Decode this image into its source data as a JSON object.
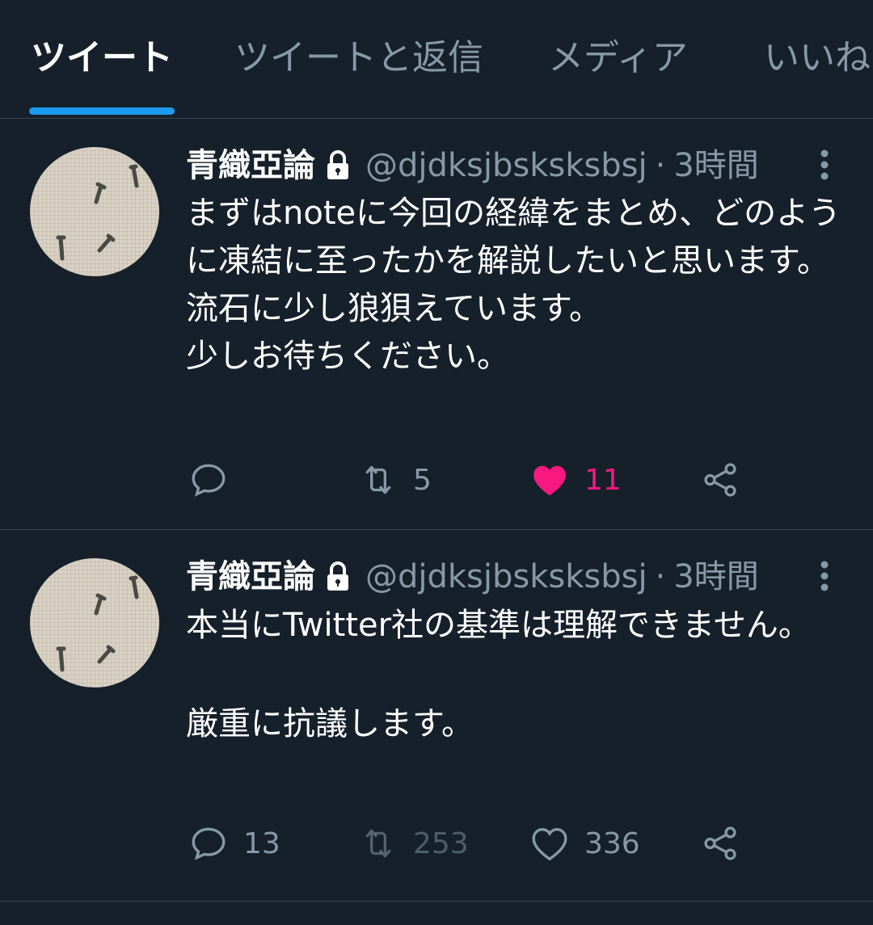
{
  "tabs": [
    {
      "label": "ツイート",
      "active": true
    },
    {
      "label": "ツイートと返信",
      "active": false
    },
    {
      "label": "メディア",
      "active": false
    },
    {
      "label": "いいね",
      "active": false
    }
  ],
  "tweets": [
    {
      "name": "青織亞論",
      "handle": "@djdksjbsksksbsj",
      "separator": "·",
      "time": "3時間",
      "text": "まずはnoteに今回の経緯をまとめ、どのように凍結に至ったかを解説したいと思います。\n流石に少し狼狽えています。\n少しお待ちください。",
      "replies": "",
      "retweets": "5",
      "likes": "11",
      "liked": true
    },
    {
      "name": "青織亞論",
      "handle": "@djdksjbsksksbsj",
      "separator": "·",
      "time": "3時間",
      "text": "本当にTwitter社の基準は理解できません。\n\n厳重に抗議します。",
      "replies": "13",
      "retweets": "253",
      "likes": "336",
      "liked": false
    }
  ],
  "colors": {
    "background": "#15202b",
    "accent": "#1d9bf0",
    "like": "#f91880",
    "secondary_text": "#8899a6",
    "divider": "#38444d"
  },
  "icons": {
    "lock": "lock-icon",
    "more": "more-vertical-icon",
    "reply": "reply-icon",
    "retweet": "retweet-icon",
    "like": "heart-icon",
    "share": "share-icon"
  }
}
